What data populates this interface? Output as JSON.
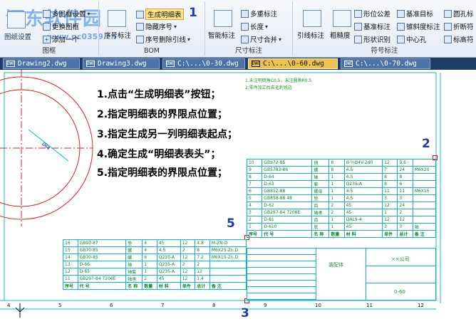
{
  "watermark": {
    "text": "河东软件园",
    "url": "www.pc0359.cn"
  },
  "ribbon": {
    "groups": {
      "tuxing": "图框",
      "bom": "BOM",
      "size": "尺寸标注",
      "symbol": "符号标注"
    },
    "items": {
      "multi_frame": "多图框设置",
      "change_frame": "更换图框",
      "add_one": "添加一个",
      "tuxing_left": "图纸设置",
      "seq_label": "序号标注",
      "gen_bom": "生成明细表",
      "hide_seq": "隐藏序号",
      "seq_delete": "序号删除引线",
      "smart_dim": "智能标注",
      "multi_dim": "多重标注",
      "length": "长度",
      "dim_merge": "尺寸合并",
      "leader": "引线标注",
      "rough": "粗糙度",
      "form_tol": "形位公差",
      "datum_mark": "基准目标",
      "datum_sym": "基准标注",
      "taper": "锥斜度标注",
      "shape_id": "形状识别",
      "center_hole": "中心孔",
      "round_hole": "圆孔标",
      "break": "折断符",
      "mark_high": "标高符"
    },
    "callout_1": "1"
  },
  "tabs": [
    {
      "label": "Drawing2.dwg"
    },
    {
      "label": "Drawing3.dwg"
    },
    {
      "label": "C:\\...\\0-30.dwg"
    },
    {
      "label": "C:\\...\\0-60.dwg"
    },
    {
      "label": "C:\\...\\0-70.dwg"
    }
  ],
  "steps": [
    "1.点击“生成明细表”按钮；",
    "2.指定明细表的界限点位置；",
    "3.指定生成另一列明细表起点；",
    "4.确定生成“明细表表头”；",
    "5.指定明细表的界限点位置；"
  ],
  "callouts": {
    "two": "2",
    "three": "3",
    "five": "5"
  },
  "dim_text": "Ø68",
  "notes": [
    "1.未注明倒角C0.5，未注圆角R0.5",
    "2.零件加工后去毛刺锐边"
  ],
  "right_table": {
    "rows": [
      [
        "10",
        "GB972-85",
        "销",
        "8",
        "d-½Ø4V-2d0",
        "12",
        "9.6",
        ""
      ],
      [
        "9",
        "GB5783-86",
        "螺",
        "8",
        "4.5",
        "7",
        "24",
        "M6X20"
      ],
      [
        "8",
        "D-64",
        "轴",
        "1",
        "4.5",
        "8",
        "8",
        ""
      ],
      [
        "7",
        "D-63",
        "套",
        "1",
        "Q235-A",
        "8",
        "6",
        ""
      ],
      [
        "6",
        "GB812-88",
        "螺母",
        "1",
        "4.5",
        "11",
        "11",
        "M6X15"
      ],
      [
        "5",
        "GB858-88 48",
        "垫",
        "1",
        "4.5",
        "3",
        "3",
        ""
      ],
      [
        "4",
        "D-62",
        "齿",
        "2",
        "45",
        "12",
        "24",
        ""
      ],
      [
        "3",
        "GB297-84 7208E",
        "轴承",
        "2",
        "45",
        "1",
        "2",
        ""
      ],
      [
        "2",
        "D-61",
        "齿",
        "1",
        "QAL9-4",
        "12",
        "12",
        ""
      ],
      [
        "1",
        "D-610",
        "底",
        "1",
        "45",
        "3",
        "3",
        "轴"
      ]
    ],
    "header": [
      "序号",
      "代 号",
      "名 称",
      "数量",
      "材 料",
      "单件",
      "总计",
      "备 注"
    ]
  },
  "left_table": {
    "rows": [
      [
        "16",
        "GB93-87",
        "垫",
        "4",
        "45",
        "12",
        "4.8",
        "M-ZN-D"
      ],
      [
        "15",
        "GB70-85",
        "螺",
        "4",
        "4.5",
        "2",
        "8",
        "M6X25-Zn.D"
      ],
      [
        "14",
        "GB70-85",
        "螺",
        "6",
        "Q235-A",
        "12",
        "7.2",
        "M6X15-Zn.D"
      ],
      [
        "13",
        "D-66",
        "轴",
        "1",
        "Q235-A",
        "2",
        "2",
        ""
      ],
      [
        "12",
        "D-65",
        "轴套",
        "1",
        "Q235-A",
        "12",
        "12",
        ""
      ],
      [
        "11",
        "GB297-84 7206E",
        "轴承",
        "2",
        "45",
        "12",
        "1.4",
        ""
      ]
    ],
    "header": [
      "序号",
      "代 号",
      "名 称",
      "数量",
      "材 料",
      "单件",
      "总计",
      "备 注"
    ]
  },
  "title_block": {
    "name": "装配体",
    "company": "××公司",
    "code": "0-60"
  },
  "ruler": {
    "labels": [
      "4",
      "5",
      "6",
      "7",
      "8",
      "9",
      "10",
      "11",
      "12"
    ]
  },
  "colors": {
    "accent": "#1c3fa0",
    "cad_line": "#11b8c8",
    "red_line": "#e02020",
    "tab_active": "#e9c34c"
  }
}
